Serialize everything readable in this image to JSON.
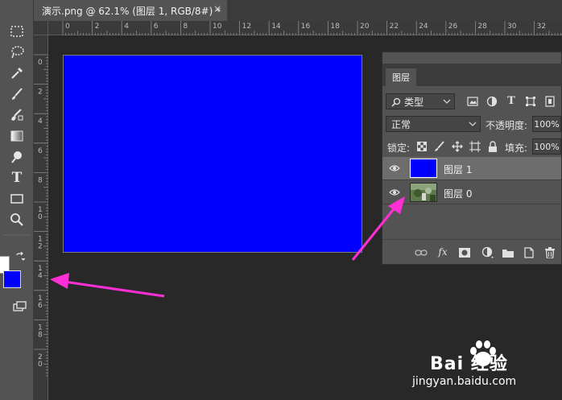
{
  "document_tab": {
    "title": "演示.png @ 62.1% (图层 1, RGB/8#) *",
    "close": "×"
  },
  "rulers": {
    "top_labels": [
      "0",
      "2",
      "4",
      "6",
      "8",
      "10",
      "12",
      "14",
      "16",
      "18",
      "20",
      "22",
      "24",
      "26",
      "28",
      "30",
      "32"
    ],
    "left_labels": [
      "0",
      "2",
      "4",
      "6",
      "8",
      "10",
      "12",
      "14",
      "16",
      "18",
      "20"
    ]
  },
  "canvas": {
    "fill_color": "#0000ff"
  },
  "tools": [
    {
      "name": "marquee-icon"
    },
    {
      "name": "lasso-icon"
    },
    {
      "name": "eyedropper-icon"
    },
    {
      "name": "brush-icon"
    },
    {
      "name": "clone-stamp-icon"
    },
    {
      "name": "gradient-icon"
    },
    {
      "name": "dodge-icon"
    },
    {
      "name": "type-tool-icon",
      "glyph": "T"
    },
    {
      "name": "rectangle-tool-icon"
    },
    {
      "name": "zoom-icon"
    }
  ],
  "colors": {
    "foreground": "#0000ff",
    "background": "#ffffff"
  },
  "layers_panel": {
    "tab": "图层",
    "collapse": "◂◂",
    "filter_kind": "类型",
    "blend_mode": "正常",
    "opacity_label": "不透明度:",
    "opacity_value": "100%",
    "lock_label": "锁定:",
    "fill_label": "填充:",
    "fill_value": "100%",
    "layers": [
      {
        "name": "图层 1",
        "selected": true,
        "thumb": "#0000ff"
      },
      {
        "name": "图层 0",
        "selected": false,
        "thumb": "photo"
      }
    ],
    "bottom_fx": "fx"
  },
  "annotation": {
    "arrow_color": "#ff2fd6"
  },
  "watermark": {
    "brand": "Bai 经验",
    "url": "jingyan.baidu.com"
  }
}
